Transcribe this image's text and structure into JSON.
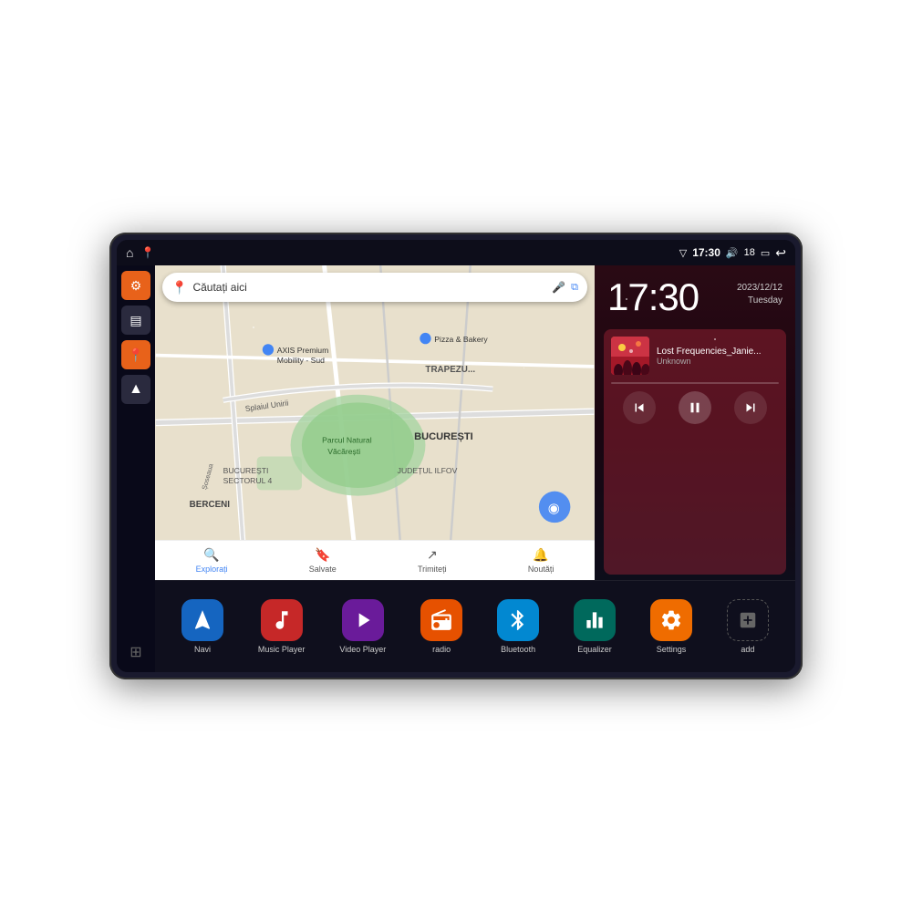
{
  "device": {
    "status_bar": {
      "left_icons": [
        "home",
        "map-pin"
      ],
      "time": "17:30",
      "right_icons": [
        "wifi",
        "volume",
        "18",
        "battery",
        "back"
      ]
    },
    "clock": {
      "time": "17:30",
      "date": "2023/12/12",
      "day": "Tuesday"
    },
    "map": {
      "search_placeholder": "Căutați aici",
      "places": [
        "AXIS Premium Mobility - Sud",
        "Pizza & Bakery",
        "Parcul Natural Văcărești",
        "BUCUREȘTI",
        "BUCUREȘTI SECTORUL 4",
        "BERCENI",
        "JUDEȚUL ILFOV",
        "TRAPEZU..."
      ],
      "tabs": [
        {
          "label": "Explorați",
          "active": true
        },
        {
          "label": "Salvate",
          "active": false
        },
        {
          "label": "Trimiteți",
          "active": false
        },
        {
          "label": "Noutăți",
          "active": false
        }
      ]
    },
    "music": {
      "title": "Lost Frequencies_Janie...",
      "artist": "Unknown",
      "controls": [
        "prev",
        "pause",
        "next"
      ]
    },
    "sidebar": [
      {
        "icon": "settings",
        "color": "orange"
      },
      {
        "icon": "inbox",
        "color": "dark"
      },
      {
        "icon": "map",
        "color": "orange"
      },
      {
        "icon": "navigation",
        "color": "dark"
      },
      {
        "icon": "grid",
        "color": "grid"
      }
    ],
    "apps": [
      {
        "label": "Navi",
        "icon": "navigation",
        "color": "blue"
      },
      {
        "label": "Music Player",
        "icon": "music",
        "color": "red"
      },
      {
        "label": "Video Player",
        "icon": "video",
        "color": "purple"
      },
      {
        "label": "radio",
        "icon": "radio",
        "color": "orange"
      },
      {
        "label": "Bluetooth",
        "icon": "bluetooth",
        "color": "blue-light"
      },
      {
        "label": "Equalizer",
        "icon": "equalizer",
        "color": "teal"
      },
      {
        "label": "Settings",
        "icon": "settings",
        "color": "orange2"
      },
      {
        "label": "add",
        "icon": "add",
        "color": "grid"
      }
    ]
  }
}
